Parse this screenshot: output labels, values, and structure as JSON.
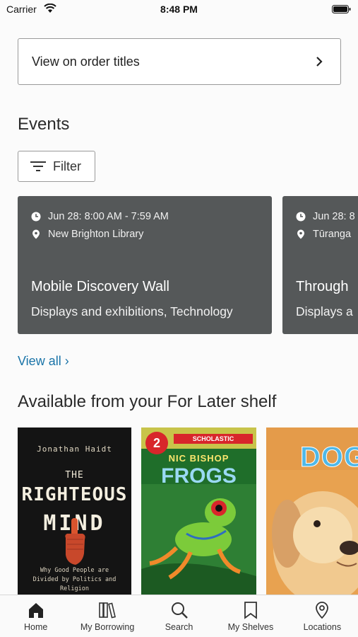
{
  "status_bar": {
    "carrier": "Carrier",
    "time": "8:48 PM"
  },
  "order_titles": {
    "label": "View on order titles"
  },
  "events": {
    "title": "Events",
    "filter_label": "Filter",
    "cards": [
      {
        "time": "Jun 28: 8:00 AM - 7:59 AM",
        "location": "New Brighton Library",
        "title": "Mobile Discovery Wall",
        "categories": "Displays and exhibitions, Technology"
      },
      {
        "time": "Jun 28: 8",
        "location": "Tūranga",
        "title": "Through",
        "categories": "Displays a"
      }
    ],
    "view_all": "View all ›"
  },
  "shelf": {
    "title": "Available from your For Later shelf",
    "books": [
      {
        "author": "Jonathan Haidt",
        "title_prefix": "THE",
        "title_line1": "RIGHTEOUS",
        "title_line2": "MIND",
        "subtitle": "Why Good People are Divided by Politics and Religion"
      },
      {
        "level": "2",
        "publisher": "SCHOLASTIC",
        "author": "NIC BISHOP",
        "title": "FROGS"
      },
      {
        "title": "DOGS"
      }
    ]
  },
  "tab_bar": {
    "tabs": [
      {
        "label": "Home",
        "icon": "home-icon"
      },
      {
        "label": "My Borrowing",
        "icon": "books-icon"
      },
      {
        "label": "Search",
        "icon": "search-icon"
      },
      {
        "label": "My Shelves",
        "icon": "bookmark-icon"
      },
      {
        "label": "Locations",
        "icon": "location-pin-icon"
      }
    ]
  }
}
